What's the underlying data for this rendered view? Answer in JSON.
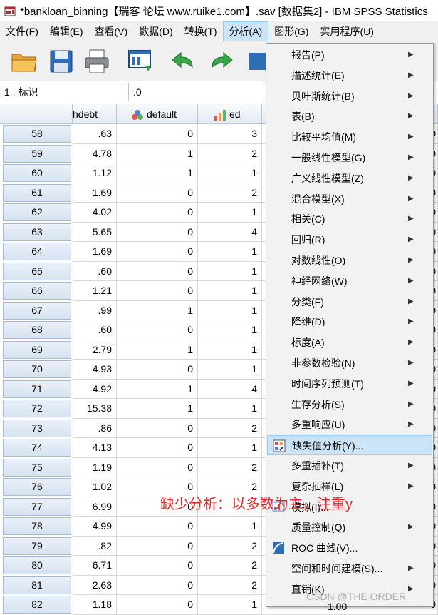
{
  "window": {
    "title": "*bankloan_binning【瑞客 论坛 www.ruike1.com】.sav [数据集2] - IBM SPSS Statistics"
  },
  "menubar": {
    "items": [
      "文件(F)",
      "编辑(E)",
      "查看(V)",
      "数据(D)",
      "转换(T)",
      "分析(A)",
      "图形(G)",
      "实用程序(U)"
    ],
    "active": "分析(A)"
  },
  "cellbar": {
    "ref": "1 : 标识",
    "value": ".0"
  },
  "columns": {
    "c1": "hdebt",
    "c2": "default",
    "c3": "ed"
  },
  "rows": [
    {
      "n": "58",
      "hdebt": ".63",
      "default": "0",
      "ed": "3",
      "x": "0"
    },
    {
      "n": "59",
      "hdebt": "4.78",
      "default": "1",
      "ed": "2",
      "x": "0"
    },
    {
      "n": "60",
      "hdebt": "1.12",
      "default": "1",
      "ed": "1",
      "x": "0"
    },
    {
      "n": "61",
      "hdebt": "1.69",
      "default": "0",
      "ed": "2",
      "x": "0"
    },
    {
      "n": "62",
      "hdebt": "4.02",
      "default": "0",
      "ed": "1",
      "x": "0"
    },
    {
      "n": "63",
      "hdebt": "5.65",
      "default": "0",
      "ed": "4",
      "x": "0"
    },
    {
      "n": "64",
      "hdebt": "1.69",
      "default": "0",
      "ed": "1",
      "x": "0"
    },
    {
      "n": "65",
      "hdebt": ".60",
      "default": "0",
      "ed": "1",
      "x": "0"
    },
    {
      "n": "66",
      "hdebt": "1.21",
      "default": "0",
      "ed": "1",
      "x": "0"
    },
    {
      "n": "67",
      "hdebt": ".99",
      "default": "1",
      "ed": "1",
      "x": "0"
    },
    {
      "n": "68",
      "hdebt": ".60",
      "default": "0",
      "ed": "1",
      "x": "0"
    },
    {
      "n": "69",
      "hdebt": "2.79",
      "default": "1",
      "ed": "1",
      "x": "0"
    },
    {
      "n": "70",
      "hdebt": "4.93",
      "default": "0",
      "ed": "1",
      "x": "0"
    },
    {
      "n": "71",
      "hdebt": "4.92",
      "default": "1",
      "ed": "4",
      "x": "0"
    },
    {
      "n": "72",
      "hdebt": "15.38",
      "default": "1",
      "ed": "1",
      "x": "0"
    },
    {
      "n": "73",
      "hdebt": ".86",
      "default": "0",
      "ed": "2",
      "x": "0"
    },
    {
      "n": "74",
      "hdebt": "4.13",
      "default": "0",
      "ed": "1",
      "x": "0"
    },
    {
      "n": "75",
      "hdebt": "1.19",
      "default": "0",
      "ed": "2",
      "x": "0"
    },
    {
      "n": "76",
      "hdebt": "1.02",
      "default": "0",
      "ed": "2",
      "x": "0"
    },
    {
      "n": "77",
      "hdebt": "6.99",
      "default": "0",
      "ed": "",
      "x": "0"
    },
    {
      "n": "78",
      "hdebt": "4.99",
      "default": "0",
      "ed": "1",
      "x": "0"
    },
    {
      "n": "79",
      "hdebt": ".82",
      "default": "0",
      "ed": "2",
      "x": "0"
    },
    {
      "n": "80",
      "hdebt": "6.71",
      "default": "0",
      "ed": "2",
      "x": "0"
    },
    {
      "n": "81",
      "hdebt": "2.63",
      "default": "0",
      "ed": "2",
      "x": "0"
    },
    {
      "n": "82",
      "hdebt": "1.18",
      "default": "0",
      "ed": "1",
      "x": "0"
    }
  ],
  "analyze_menu": [
    {
      "label": "报告(P)",
      "submenu": true
    },
    {
      "label": "描述统计(E)",
      "submenu": true
    },
    {
      "label": "贝叶斯统计(B)",
      "submenu": true
    },
    {
      "label": "表(B)",
      "submenu": true
    },
    {
      "label": "比较平均值(M)",
      "submenu": true
    },
    {
      "label": "一般线性模型(G)",
      "submenu": true
    },
    {
      "label": "广义线性模型(Z)",
      "submenu": true
    },
    {
      "label": "混合模型(X)",
      "submenu": true
    },
    {
      "label": "相关(C)",
      "submenu": true
    },
    {
      "label": "回归(R)",
      "submenu": true
    },
    {
      "label": "对数线性(O)",
      "submenu": true
    },
    {
      "label": "神经网络(W)",
      "submenu": true
    },
    {
      "label": "分类(F)",
      "submenu": true
    },
    {
      "label": "降维(D)",
      "submenu": true
    },
    {
      "label": "标度(A)",
      "submenu": true
    },
    {
      "label": "非参数检验(N)",
      "submenu": true
    },
    {
      "label": "时间序列预测(T)",
      "submenu": true
    },
    {
      "label": "生存分析(S)",
      "submenu": true
    },
    {
      "label": "多重响应(U)",
      "submenu": true
    },
    {
      "label": "缺失值分析(Y)...",
      "submenu": false,
      "highlighted": true,
      "icon": "missing-value-icon"
    },
    {
      "label": "多重插补(T)",
      "submenu": true
    },
    {
      "label": "复杂抽样(L)",
      "submenu": true
    },
    {
      "label": "模拟(I)...",
      "submenu": false,
      "icon": "simulation-icon"
    },
    {
      "label": "质量控制(Q)",
      "submenu": true
    },
    {
      "label": "ROC 曲线(V)...",
      "submenu": false,
      "icon": "roc-curve-icon"
    },
    {
      "label": "空间和时间建模(S)...",
      "submenu": true
    },
    {
      "label": "直销(K)",
      "submenu": true
    }
  ],
  "annotation": "缺少分析：以多数为主，注重y",
  "watermark": "CSDN @THE ORDER",
  "partial_value": "1.00"
}
